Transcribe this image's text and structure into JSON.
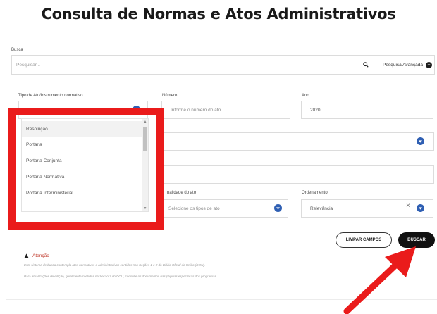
{
  "page": {
    "title": "Consulta de Normas e Atos Administrativos"
  },
  "search": {
    "label": "Busca",
    "placeholder": "Pesquisar...",
    "advanced_label": "Pesquisa Avançada",
    "advanced_icon": "plus-circle-icon"
  },
  "form": {
    "tipo_label": "Tipo de Ato/Instrumento normativo",
    "numero_label": "Número",
    "numero_placeholder": "Informe o número do ato",
    "ano_label": "Ano",
    "ano_value": "2020",
    "finalidade_label": "nalidade do ato",
    "finalidade_placeholder": "Selecione os tipos de ato",
    "ordenamento_label": "Ordenamento",
    "ordenamento_value": "Relevância"
  },
  "dropdown": {
    "items": [
      "Resolução",
      "Portaria",
      "Portaria Conjunta",
      "Portaria Normativa",
      "Portaria Interministerial"
    ]
  },
  "buttons": {
    "clear_label": "LIMPAR CAMPOS",
    "search_label": "BUSCAR"
  },
  "notice": {
    "attention_label": "Atenção",
    "line1": "Este sistema de busca contempla atos normativos e administrativos contidos nas Seções 1 e 2 do Diário Oficial da União (DOU).",
    "line2": "Para atualizações de edição, geralmente contidos na Seção 3 do DOU, consulte os documentos nas páginas específicas dos programas."
  },
  "colors": {
    "accent_blue": "#2f5fb3",
    "highlight_red": "#ea1b1b",
    "attention_red": "#c0392b"
  }
}
